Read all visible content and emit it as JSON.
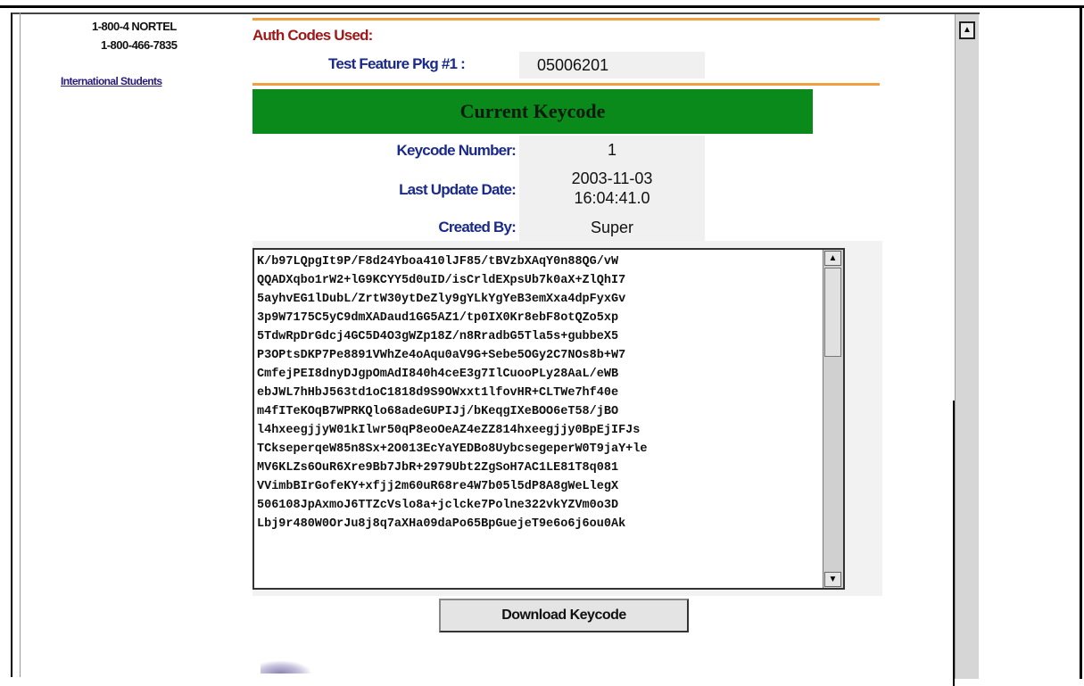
{
  "sidebar": {
    "phone_line1": "1-800-4 NORTEL",
    "phone_line2": "1-800-466-7835",
    "intl_link": "International Students"
  },
  "auth": {
    "label": "Auth Codes Used:",
    "feature_label": "Test Feature Pkg #1 :",
    "feature_value": "05006201"
  },
  "current": {
    "header": "Current Keycode",
    "keycode_number_label": "Keycode Number:",
    "keycode_number": "1",
    "last_update_label": "Last Update Date:",
    "last_update_date": "2003-11-03",
    "last_update_time": "16:04:41.0",
    "created_by_label": "Created By:",
    "created_by": "Super"
  },
  "keycode_text": {
    "lines": [
      "K/b97LQpgIt9P/F8d24Yboa410lJF85/tBVzbXAqY0n88QG/vW",
      "QQADXqbo1rW2+lG9KCYY5d0uID/isCrldEXpsUb7k0aX+ZlQhI7",
      "5ayhvEG1lDubL/ZrtW30ytDeZly9gYLkYgYeB3emXxa4dpFyxGv",
      "3p9W7175C5yC9dmXADaud1GG5AZ1/tp0IX0Kr8ebF8otQZo5xp",
      "5TdwRpDrGdcj4GC5D4O3gWZp18Z/n8RradbG5Tla5s+gubbeX5",
      "P3OPtsDKP7Pe8891VWhZe4oAqu0aV9G+Sebe5OGy2C7NOs8b+W7",
      "CmfejPEI8dnyDJgpOmAdI840h4ceE3g7IlCuooPLy28AaL/eWB",
      "ebJWL7hHbJ563td1oC1818d9S9OWxxt1lfovHR+CLTWe7hf40e",
      "m4fITeKOqB7WPRKQlo68adeGUPIJj/bKeqgIXeBOO6eT58/jBO",
      "l4hxeegjjyW01kIlwr50qP8eoOeAZ4eZZ814hxeegjjy0BpEjIFJs",
      "TCkseperqeW85n8Sx+2O013EcYaYEDBo8UybcsegeperW0T9jaY+le",
      "MV6KLZs6OuR6Xre9Bb7JbR+2979Ubt2ZgSoH7AC1LE81T8q081",
      "VVimbBIrGofeKY+xfjj2m60uR68re4W7b05l5dP8A8gWeLlegX",
      "506108JpAxmoJ6TTZcVslo8a+jclcke7Polne322vkYZVm0o3D",
      "Lbj9r480W0OrJu8j8q7aXHa09daPo65BpGuejeT9e6o6j6ou0Ak"
    ]
  },
  "download_button": "Download Keycode"
}
